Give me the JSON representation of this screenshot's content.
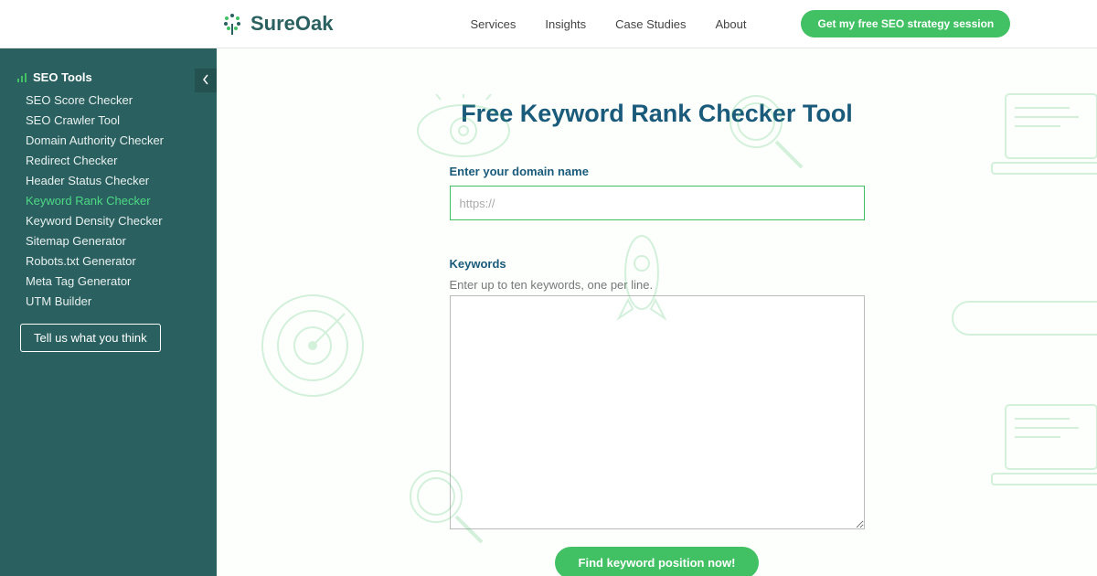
{
  "header": {
    "brand": "SureOak",
    "nav": [
      "Services",
      "Insights",
      "Case Studies",
      "About"
    ],
    "cta": "Get my free SEO strategy session"
  },
  "sidebar": {
    "title": "SEO Tools",
    "items": [
      "SEO Score Checker",
      "SEO Crawler Tool",
      "Domain Authority Checker",
      "Redirect Checker",
      "Header Status Checker",
      "Keyword Rank Checker",
      "Keyword Density Checker",
      "Sitemap Generator",
      "Robots.txt Generator",
      "Meta Tag Generator",
      "UTM Builder"
    ],
    "active_index": 5,
    "feedback": "Tell us what you think"
  },
  "main": {
    "title": "Free Keyword Rank Checker Tool",
    "domain_label": "Enter your domain name",
    "domain_placeholder": "https://",
    "keywords_label": "Keywords",
    "keywords_hint": "Enter up to ten keywords, one per line.",
    "submit": "Find keyword position now!"
  },
  "colors": {
    "teal": "#2a6160",
    "green": "#42c064",
    "title_blue": "#1a5a7a"
  }
}
